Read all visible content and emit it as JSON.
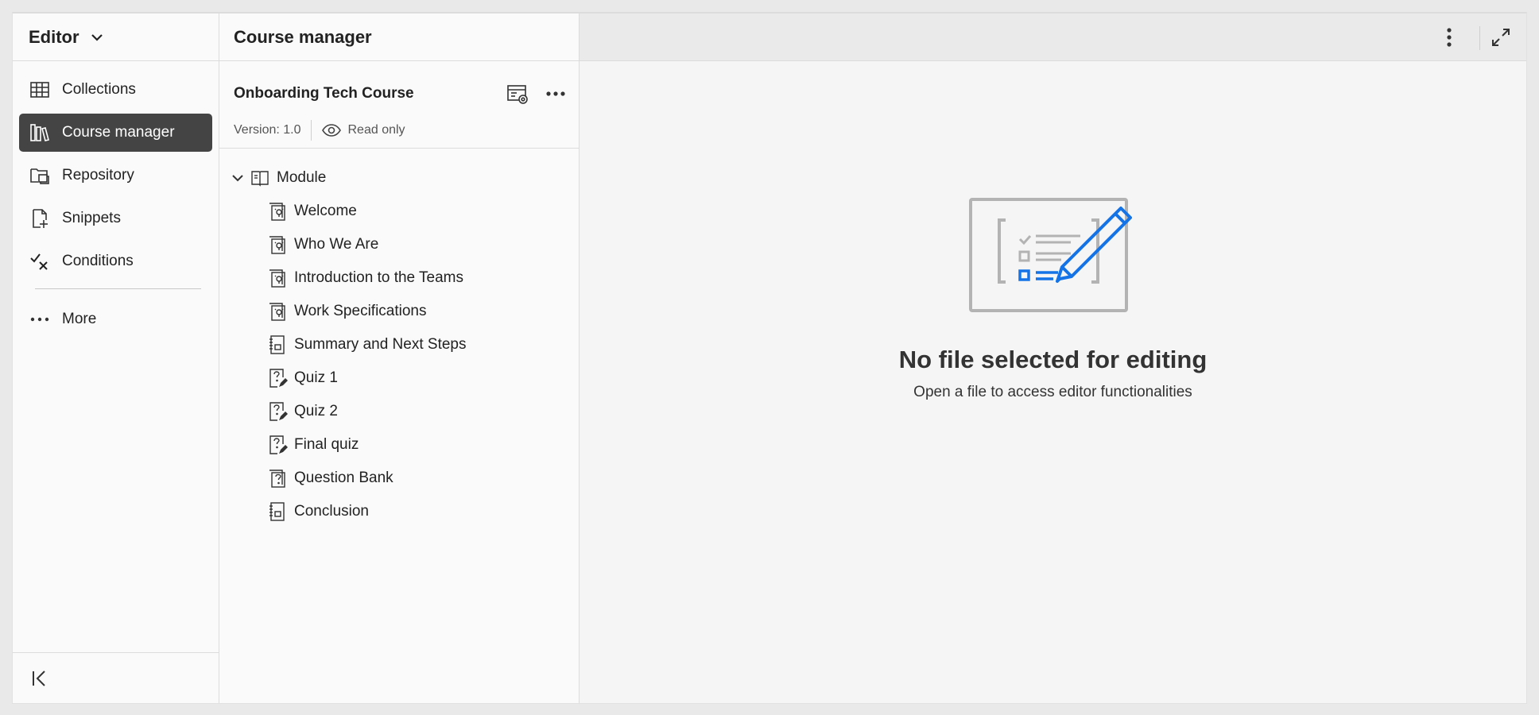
{
  "leftnav": {
    "title": "Editor",
    "items": [
      {
        "label": "Collections",
        "icon": "grid-icon"
      },
      {
        "label": "Course manager",
        "icon": "library-icon",
        "active": true
      },
      {
        "label": "Repository",
        "icon": "folder-icon"
      },
      {
        "label": "Snippets",
        "icon": "snippet-icon"
      },
      {
        "label": "Conditions",
        "icon": "conditions-icon"
      }
    ],
    "more_label": "More"
  },
  "course_manager": {
    "title": "Course manager",
    "course_title": "Onboarding Tech Course",
    "version": "Version: 1.0",
    "read_only": "Read only",
    "module_label": "Module",
    "items": [
      {
        "label": "Welcome",
        "icon": "lesson-icon"
      },
      {
        "label": "Who We Are",
        "icon": "lesson-icon"
      },
      {
        "label": "Introduction to the Teams",
        "icon": "lesson-icon"
      },
      {
        "label": "Work Specifications",
        "icon": "lesson-icon"
      },
      {
        "label": "Summary and Next Steps",
        "icon": "summary-icon"
      },
      {
        "label": "Quiz 1",
        "icon": "quiz-icon"
      },
      {
        "label": "Quiz 2",
        "icon": "quiz-icon"
      },
      {
        "label": "Final quiz",
        "icon": "quiz-icon"
      },
      {
        "label": "Question Bank",
        "icon": "question-bank-icon"
      },
      {
        "label": "Conclusion",
        "icon": "summary-icon"
      }
    ]
  },
  "main": {
    "empty_title": "No file selected for editing",
    "empty_subtitle": "Open a file to access editor functionalities"
  },
  "colors": {
    "active_nav_bg": "#444444",
    "illustration_accent": "#1473e6",
    "illustration_gray": "#b3b3b3"
  }
}
